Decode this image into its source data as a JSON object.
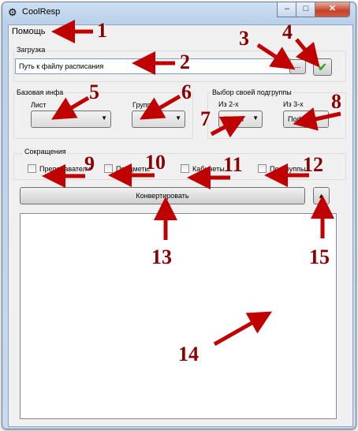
{
  "window": {
    "title": "CoolResp",
    "app_icon": "gear-app-icon",
    "controls": {
      "minimize": "–",
      "maximize": "□",
      "close": "✕"
    }
  },
  "menu": {
    "items": [
      {
        "label": "Помощь"
      }
    ]
  },
  "load_group": {
    "label": "Загрузка",
    "path_value": "Путь к файлу расписания",
    "browse_label": "...",
    "ok_icon": "checkmark-icon",
    "ok_color": "#2ea82e"
  },
  "base_info": {
    "label": "Базовая инфа",
    "sheet_label": "Лист",
    "group_label": "Группа",
    "sheet_value": "",
    "group_value": ""
  },
  "subgroup": {
    "label": "Выбор своей подгруппы",
    "of_two_label": "Из 2-х",
    "of_three_label": "Из 3-х",
    "of_two_value": "Пофиг",
    "of_three_value": "Пофиг"
  },
  "abbreviations": {
    "label": "Сокращения",
    "options": [
      {
        "label": "Преподаватели",
        "checked": false
      },
      {
        "label": "Предметы",
        "checked": false
      },
      {
        "label": "Кабинеты",
        "checked": false
      },
      {
        "label": "Подгруппы",
        "checked": false
      }
    ]
  },
  "convert_label": "Конвертировать",
  "toggle_label": "▲",
  "annotations": {
    "color": "#c00000",
    "numbers": [
      "1",
      "2",
      "3",
      "4",
      "5",
      "6",
      "7",
      "8",
      "9",
      "10",
      "11",
      "12",
      "13",
      "14",
      "15"
    ]
  }
}
